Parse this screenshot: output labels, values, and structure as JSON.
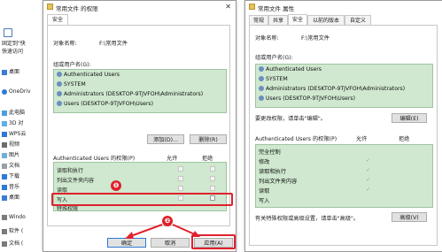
{
  "explorer": {
    "items": [
      {
        "label": "固定到\"快",
        "icon": "pin-icon"
      },
      {
        "label": "快速访问",
        "icon": "star-icon"
      },
      {
        "label": "桌面",
        "icon": "desktop-icon"
      },
      {
        "label": "OneDriv",
        "icon": "cloud-icon"
      },
      {
        "label": "此电脑",
        "icon": "pc-icon"
      },
      {
        "label": "3D 对",
        "icon": "cube-icon"
      },
      {
        "label": "WPS云",
        "icon": "cloud-icon"
      },
      {
        "label": "视频",
        "icon": "video-icon"
      },
      {
        "label": "图片",
        "icon": "image-icon"
      },
      {
        "label": "文档",
        "icon": "doc-icon"
      },
      {
        "label": "下载",
        "icon": "download-icon"
      },
      {
        "label": "音乐",
        "icon": "music-icon"
      },
      {
        "label": "桌面",
        "icon": "desktop-icon"
      },
      {
        "label": "Windo",
        "icon": "drive-icon"
      },
      {
        "label": "软件 (",
        "icon": "drive-icon"
      },
      {
        "label": "文档 (",
        "icon": "drive-icon"
      }
    ]
  },
  "perm_dialog": {
    "title": "常用文件 的权限",
    "tab": "安全",
    "object_label": "对象名称:",
    "object_value": "F:\\常用文件",
    "group_label": "组或用户名(G):",
    "users": [
      "Authenticated Users",
      "SYSTEM",
      "Administrators (DESKTOP-9TJVFOH\\Administrators)",
      "Users (DESKTOP-9TJVFOH\\Users)"
    ],
    "add_button": "添加(D)...",
    "remove_button": "删除(R)",
    "perm_header": "Authenticated Users 的权限(P)",
    "allow": "允许",
    "deny": "拒绝",
    "permissions": [
      "读取和执行",
      "列出文件夹内容",
      "读取",
      "写入",
      "特殊权限"
    ],
    "ok": "确定",
    "cancel": "取消",
    "apply": "应用(A)",
    "annot1": "❶",
    "annot2": "❷"
  },
  "props_dialog": {
    "title": "常用文件 属性",
    "tabs": [
      "常规",
      "共享",
      "安全",
      "以前的版本",
      "自定义"
    ],
    "object_label": "对象名称:",
    "object_value": "F:\\常用文件",
    "group_label": "组或用户名(G):",
    "users": [
      "Authenticated Users",
      "SYSTEM",
      "Administrators (DESKTOP-9TJVFOH\\Administrators)",
      "Users (DESKTOP-9TJVFOH\\Users)"
    ],
    "edit_hint": "要更改权限，请单击\"编辑\"。",
    "edit_button": "编辑(E)",
    "perm_header": "Authenticated Users 的权限(P)",
    "allow": "允许",
    "deny": "拒绝",
    "permissions": [
      "完全控制",
      "修改",
      "读取和执行",
      "列出文件夹内容",
      "读取",
      "写入"
    ],
    "advanced_hint": "有关特殊权限或高级设置，请单击\"高级\"。",
    "advanced_button": "高级(V)"
  },
  "colors": {
    "list_bg": "#cfe8cf",
    "highlight": "#e0212d"
  }
}
